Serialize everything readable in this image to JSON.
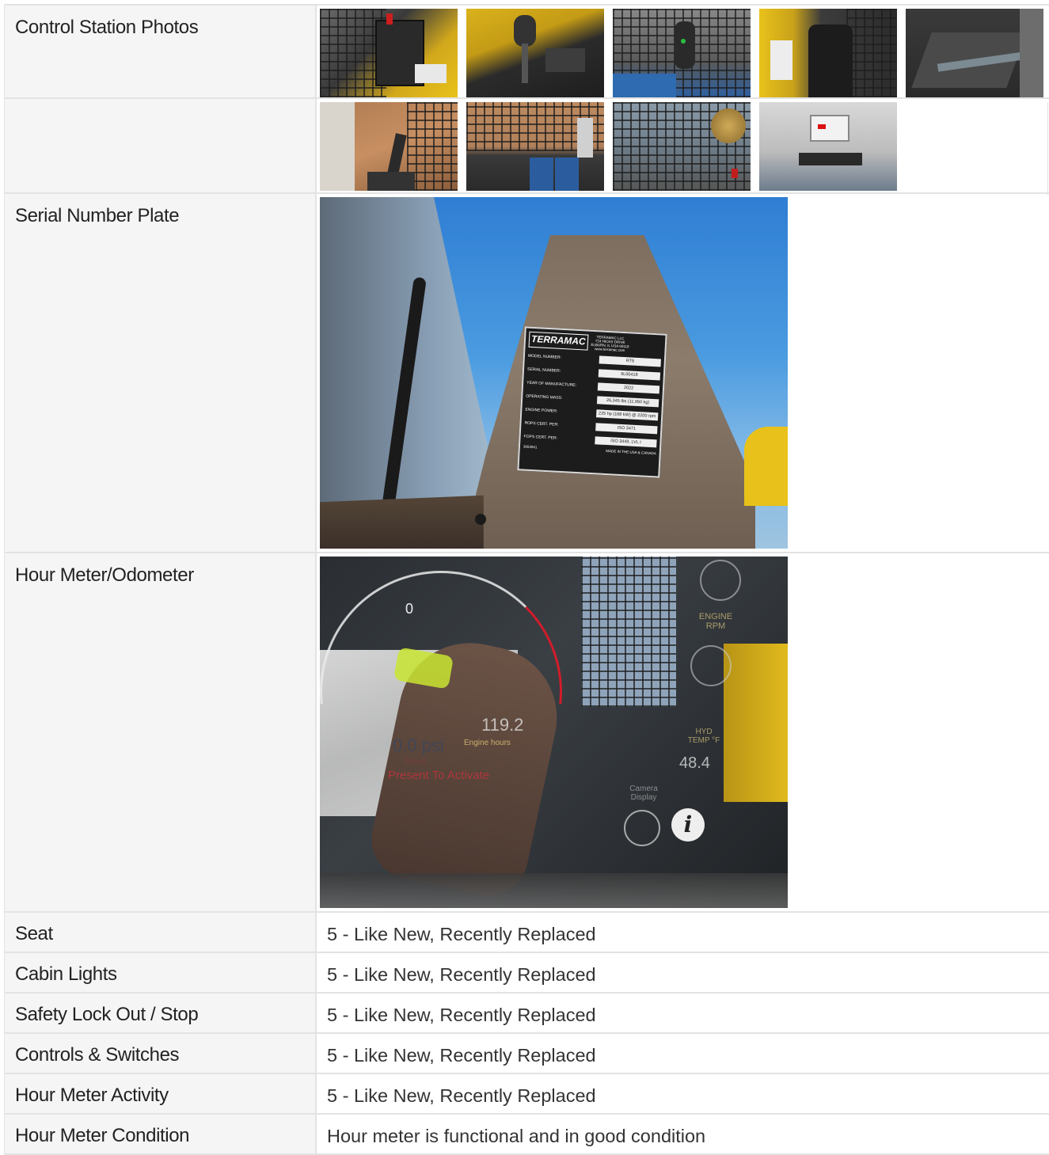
{
  "sections": {
    "control_station": {
      "label": "Control Station Photos",
      "row1_photos": [
        "control-station-photo-1",
        "control-station-photo-2",
        "control-station-photo-3",
        "control-station-photo-4",
        "control-station-photo-5"
      ],
      "row2_photos": [
        "control-station-photo-6",
        "control-station-photo-7",
        "control-station-photo-8",
        "control-station-photo-9"
      ]
    },
    "serial_plate": {
      "label": "Serial Number Plate",
      "plate": {
        "brand": "TERRAMAC",
        "company": "TERRAMAC LLC",
        "address1": "724 HICKS DRIVE",
        "address2": "ELBURN, IL USA 60119",
        "website": "www.terramac.com",
        "rows": [
          {
            "k": "MODEL NUMBER:",
            "v": "RT9"
          },
          {
            "k": "SERIAL NUMBER:",
            "v": "9L00418"
          },
          {
            "k": "YEAR OF MANUFACTURE:",
            "v": "2022"
          },
          {
            "k": "OPERATING MASS:",
            "v": "26,345 lbs (11,950 kg)"
          },
          {
            "k": "ENGINE POWER:",
            "v": "225 hp (168 kW) @ 2200 rpm"
          },
          {
            "k": "ROPS CERT. PER:",
            "v": "ISO 3471"
          },
          {
            "k": "FOPS CERT. PER:",
            "v": "ISO 3449, LVL I"
          }
        ],
        "footer_left": "3654941",
        "footer_right": "MADE IN THE USA & CANADA"
      }
    },
    "hour_meter": {
      "label": "Hour Meter/Odometer",
      "display": {
        "hours": "119.2",
        "hours_label": "Engine hours",
        "pressure": "0.0 psi",
        "pressure_label": "Boost",
        "prompt": "Present To Activate",
        "rpm_label": "ENGINE RPM",
        "hyd_label": "HYD TEMP °F",
        "hyd_value": "48.4",
        "camera_label": "Camera Display",
        "gauge_zero": "0"
      }
    }
  },
  "ratings": [
    {
      "label": "Seat",
      "value": "5 - Like New, Recently Replaced"
    },
    {
      "label": "Cabin Lights",
      "value": "5 - Like New, Recently Replaced"
    },
    {
      "label": "Safety Lock Out / Stop",
      "value": "5 - Like New, Recently Replaced"
    },
    {
      "label": "Controls & Switches",
      "value": "5 - Like New, Recently Replaced"
    },
    {
      "label": "Hour Meter Activity",
      "value": "5 - Like New, Recently Replaced"
    },
    {
      "label": "Hour Meter Condition",
      "value": "Hour meter is functional and in good condition"
    }
  ],
  "colors": {
    "label_bg": "#f5f5f5",
    "border": "#e3e3e3",
    "plate_bg": "#1c1c1c",
    "sky": "#3f8fd8",
    "machine_yellow": "#e8c21a"
  }
}
